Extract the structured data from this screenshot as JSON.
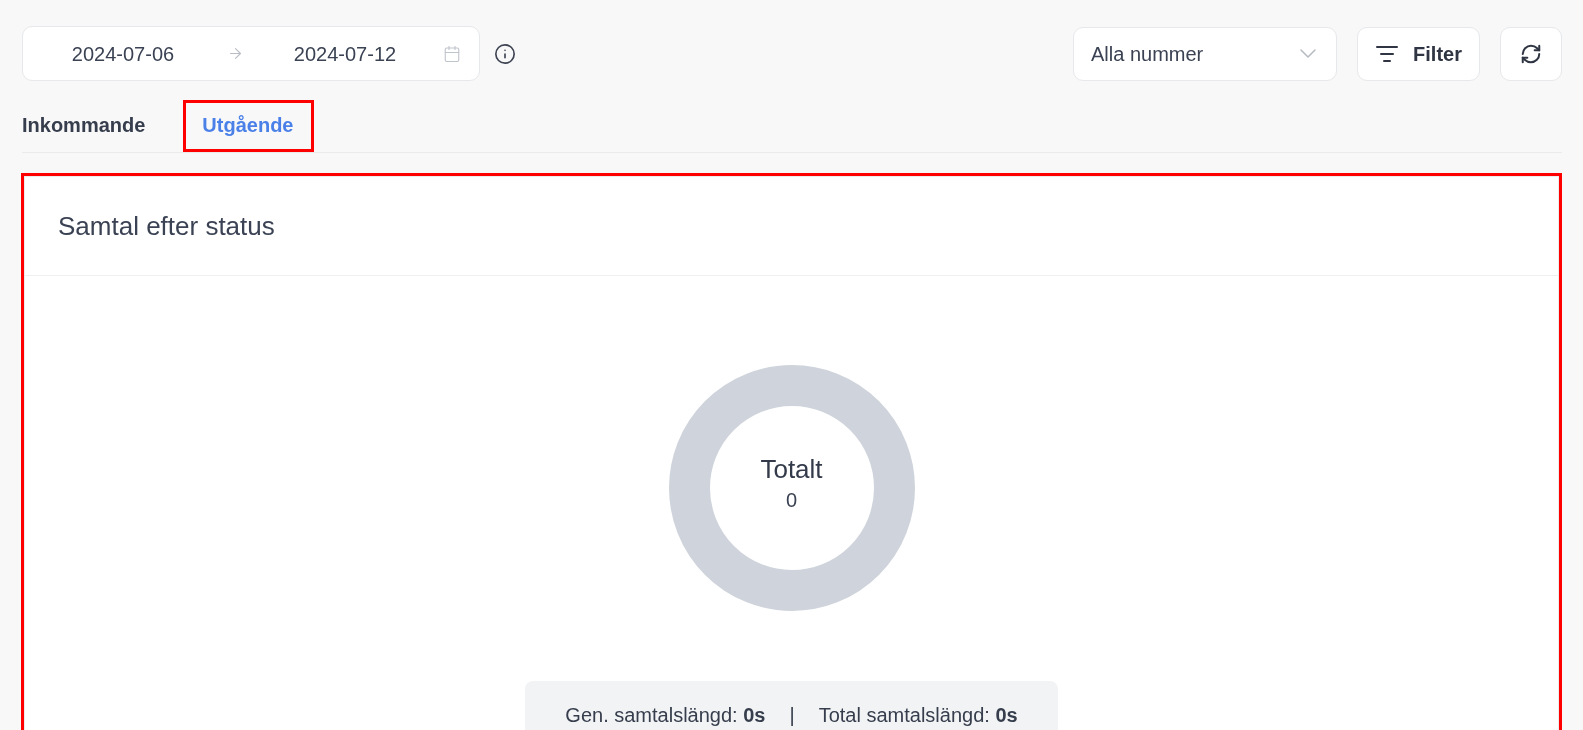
{
  "date_range": {
    "start": "2024-07-06",
    "end": "2024-07-12"
  },
  "number_select": {
    "value": "Alla nummer"
  },
  "filter_button": {
    "label": "Filter"
  },
  "tabs": [
    {
      "label": "Inkommande",
      "selected": false,
      "highlighted": false
    },
    {
      "label": "Utgående",
      "selected": true,
      "highlighted": true
    }
  ],
  "card": {
    "title": "Samtal efter status",
    "highlighted": true,
    "donut": {
      "label": "Totalt",
      "value": "0"
    },
    "summary": {
      "items": [
        "Gen. samtalslängd: **0s**",
        "Total samtalslängd: **0s**"
      ],
      "separator": "|"
    }
  }
}
